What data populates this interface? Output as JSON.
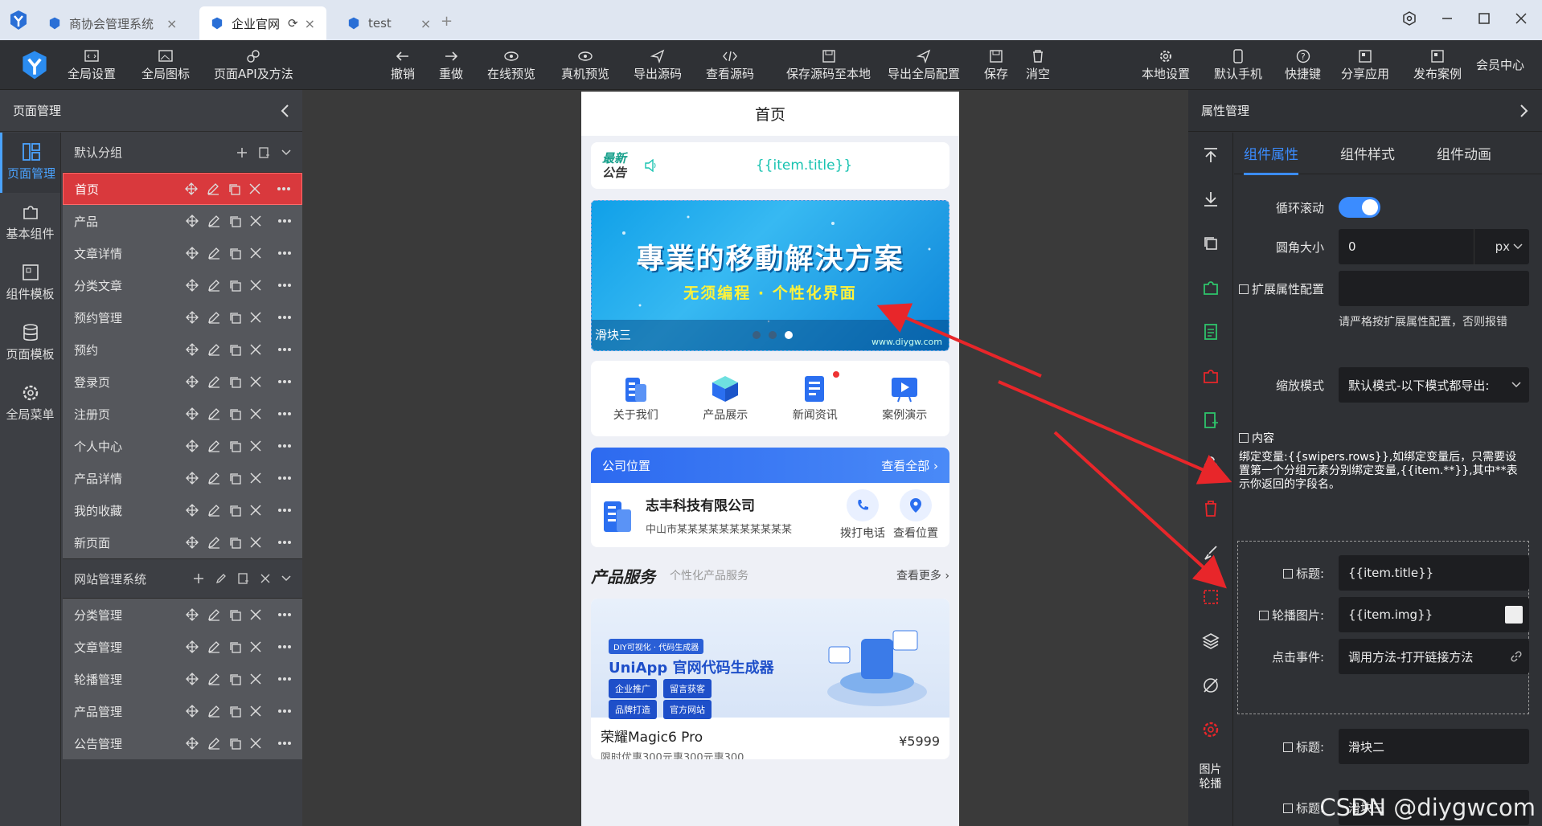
{
  "tabs": [
    {
      "label": "商协会管理系统",
      "close": "×"
    },
    {
      "label": "企业官网",
      "close": "×"
    },
    {
      "label": "test",
      "close": "×"
    }
  ],
  "tab_add": "+",
  "toolbar": {
    "items": [
      {
        "label": "全局设置",
        "icon": "settings-code-icon"
      },
      {
        "label": "全局图标",
        "icon": "image-icon"
      },
      {
        "label": "页面API及方法",
        "icon": "api-icon"
      },
      {
        "label": "撤销",
        "icon": "undo-icon"
      },
      {
        "label": "重做",
        "icon": "redo-icon"
      },
      {
        "label": "在线预览",
        "icon": "eye-icon"
      },
      {
        "label": "真机预览",
        "icon": "eye-icon"
      },
      {
        "label": "导出源码",
        "icon": "send-icon"
      },
      {
        "label": "查看源码",
        "icon": "code-icon"
      },
      {
        "label": "保存源码至本地",
        "icon": "save-icon"
      },
      {
        "label": "导出全局配置",
        "icon": "send-icon"
      },
      {
        "label": "保存",
        "icon": "save-icon"
      },
      {
        "label": "消空",
        "icon": "trash-icon"
      },
      {
        "label": "本地设置",
        "icon": "gear-icon"
      },
      {
        "label": "默认手机",
        "icon": "phone-icon"
      },
      {
        "label": "快捷键",
        "icon": "help-icon"
      },
      {
        "label": "分享应用",
        "icon": "share-icon"
      },
      {
        "label": "发布案例",
        "icon": "publish-icon"
      }
    ],
    "member": "会员中心"
  },
  "left": {
    "title": "页面管理",
    "rail": [
      "页面管理",
      "基本组件",
      "组件模板",
      "页面模板",
      "全局菜单"
    ],
    "group1": {
      "name": "默认分组",
      "pages": [
        "首页",
        "产品",
        "文章详情",
        "分类文章",
        "预约管理",
        "预约",
        "登录页",
        "注册页",
        "个人中心",
        "产品详情",
        "我的收藏",
        "新页面"
      ]
    },
    "group2": {
      "name": "网站管理系统",
      "pages": [
        "分类管理",
        "文章管理",
        "轮播管理",
        "产品管理",
        "公告管理"
      ]
    }
  },
  "phone": {
    "title": "首页",
    "notice_line1": "最新",
    "notice_line2": "公告",
    "notice_text": "{{item.title}}",
    "banner_title": "專業的移動解決方案",
    "banner_sub": "无须编程 · 个性化界面",
    "banner_caption": "滑块三",
    "banner_watermark": "www.diygw.com",
    "banner_active": 3,
    "quick": [
      "关于我们",
      "产品展示",
      "新闻资讯",
      "案例演示"
    ],
    "loc_title": "公司位置",
    "loc_more": "查看全部",
    "company": "志丰科技有限公司",
    "address": "中山市某某某某某某某某某某某",
    "call": "拨打电话",
    "view_loc": "查看位置",
    "svc_title": "产品服务",
    "svc_sub": "个性化产品服务",
    "svc_more": "查看更多",
    "prod_tag": "DIY可视化 · 代码生成器",
    "prod_headline": "UniApp 官网代码生成器",
    "prod_btns": [
      "企业推广",
      "留言获客",
      "品牌打造",
      "官方网站"
    ],
    "prod_name": "荣耀Magic6 Pro",
    "prod_desc": "限时优惠300元惠300元惠300",
    "prod_price": "¥5999"
  },
  "right": {
    "title": "属性管理",
    "tabs": [
      "组件属性",
      "组件样式",
      "组件动画"
    ],
    "tools_label": "图片轮播",
    "loop_label": "循环滚动",
    "loop_on": true,
    "radius_label": "圆角大小",
    "radius_value": "0",
    "radius_unit": "px",
    "ext_label": "扩展属性配置",
    "ext_hint": "请严格按扩展属性配置，否则报错",
    "scale_label": "缩放模式",
    "scale_value": "默认模式-以下模式都导出:",
    "content_label": "内容",
    "bind_note": "绑定变量:{{swipers.rows}},如绑定变量后，只需要设置第一个分组元素分别绑定变量,{{item.**}},其中**表示你返回的字段名。",
    "title_label": "标题:",
    "title_value": "{{item.title}}",
    "img_label": "轮播图片:",
    "img_value": "{{item.img}}",
    "click_label": "点击事件:",
    "click_value": "调用方法-打开链接方法",
    "title2_label": "标题:",
    "title2_value": "滑块二",
    "title3_label": "标题:",
    "title3_value": "滑块三"
  },
  "watermark": "CSDN @diygwcom",
  "colors": {
    "accent": "#3b8cff",
    "selected": "#d9393d",
    "arrow": "#e8262a"
  }
}
